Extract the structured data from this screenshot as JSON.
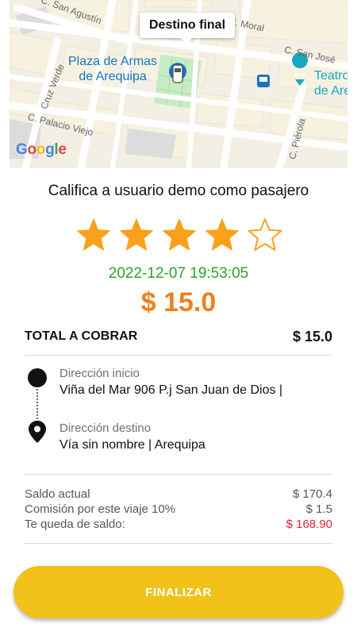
{
  "map": {
    "callout": "Destino final",
    "streets": {
      "san_agustin": "C. San Agustín",
      "moral": "C. Moral",
      "san_jose": "C. San José",
      "cruz_verde": "Cruz Verde",
      "palacio_viejo": "C. Palacio Viejo",
      "pierola": "C. Piérola"
    },
    "places": {
      "plaza_line1": "Plaza de Armas",
      "plaza_line2": "de Arequipa",
      "teatro_line1": "Teatro",
      "teatro_line2": "de Are"
    },
    "logo": {
      "letters": [
        "G",
        "o",
        "o",
        "g",
        "l",
        "e"
      ],
      "colors": [
        "#4285F4",
        "#EA4335",
        "#FBBC05",
        "#4285F4",
        "#34A853",
        "#EA4335"
      ]
    },
    "colors": {
      "land": "#f3efe4",
      "block": "#f6f1df",
      "road": "#ffffff",
      "park": "#c7ebc3",
      "label_blue": "#1a73c9",
      "teatro": "#1aa7c4"
    }
  },
  "rating": {
    "title": "Califica a usuario demo como pasajero",
    "value": 4,
    "max": 5,
    "star_color": "#f9a11b",
    "date": "2022-12-07 19:53:05",
    "amount": "$ 15.0"
  },
  "total": {
    "label": "TOTAL A COBRAR",
    "value": "$ 15.0"
  },
  "route": {
    "origin_label": "Dirección inicio",
    "origin_value": "Viña del Mar 906 P.j San Juan de Dios |",
    "destination_label": "Dirección destino",
    "destination_value": "Vía sin nombre  | Arequipa"
  },
  "balance": {
    "current_label": "Saldo actual",
    "current_value": "$ 170.4",
    "commission_label": "Comisión por este viaje 10%",
    "commission_value": "$ 1.5",
    "remaining_label": "Te queda de saldo:",
    "remaining_value": "$ 168.90"
  },
  "actions": {
    "finish_label": "FINALIZAR"
  }
}
